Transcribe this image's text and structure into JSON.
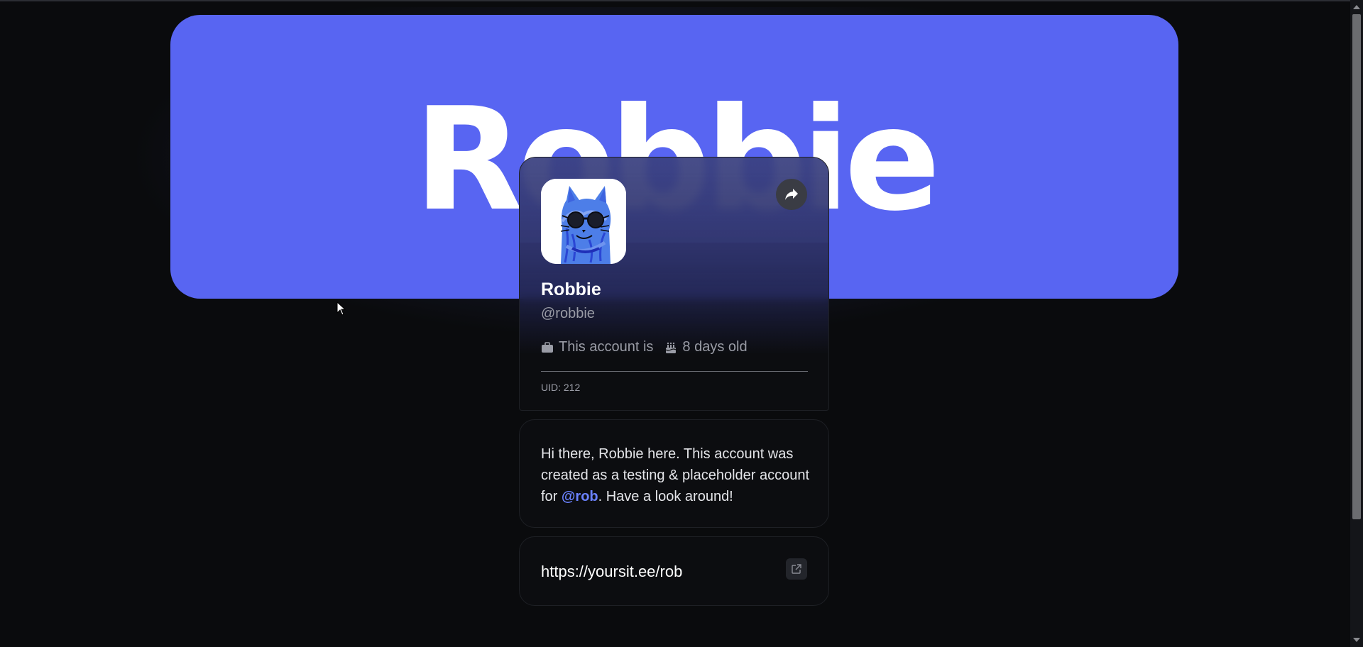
{
  "banner": {
    "text": "Robbie",
    "color": "#5865f2"
  },
  "profile": {
    "avatar_icon": "cat-drawing-avatar",
    "share_icon": "share-icon",
    "display_name": "Robbie",
    "handle": "@robbie",
    "account_status_text": "This account is",
    "account_status_icon": "briefcase-icon",
    "age_text": "8 days old",
    "age_icon": "cake-icon",
    "uid_text": "UID: 212"
  },
  "bio": {
    "before": "Hi there, Robbie here. This account was created as a testing & placeholder account for ",
    "mention": "@rob",
    "after": ". Have a look around!",
    "mention_color": "#6b82ff"
  },
  "link": {
    "url": "https://yoursit.ee/rob",
    "icon": "external-link-icon"
  }
}
